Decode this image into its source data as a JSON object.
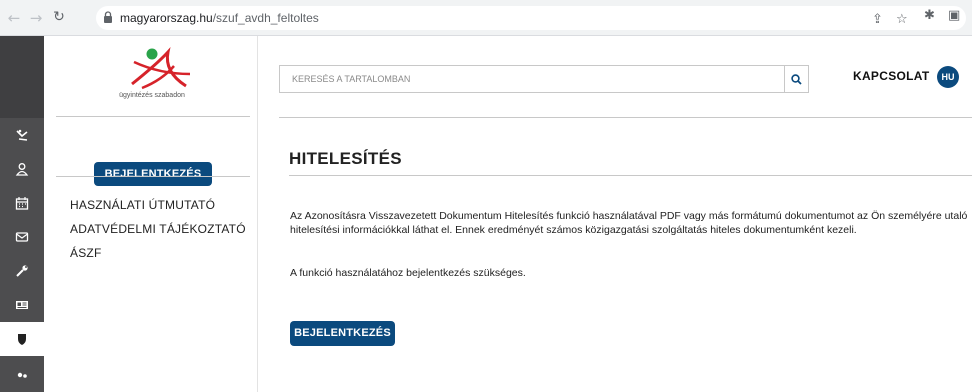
{
  "browser": {
    "url_host": "magyarorszag.hu",
    "url_path": "/szuf_avdh_feltoltes",
    "back_icon": "arrow-left-icon",
    "forward_icon": "arrow-right-icon",
    "reload_icon": "reload-icon"
  },
  "sidebar": {
    "logo_caption": "ügyintézés szabadon",
    "login_button": "BEJELENTKEZÉS",
    "links": [
      "HASZNÁLATI ÚTMUTATÓ",
      "ADATVÉDELMI TÁJÉKOZTATÓ",
      "ÁSZF"
    ]
  },
  "rail": {
    "items": [
      "person-skiing-icon",
      "user-icon",
      "calendar-icon",
      "mail-icon",
      "wrench-icon",
      "id-card-icon",
      "shield-icon",
      "users-icon"
    ],
    "active_index": 6
  },
  "header": {
    "search_placeholder": "KERESÉS A TARTALOMBAN",
    "contact": "KAPCSOLAT",
    "language": "HU"
  },
  "main": {
    "title": "HITELESÍTÉS",
    "paragraph": "Az Azonosításra Visszavezetett Dokumentum Hitelesítés funkció használatával PDF vagy más formátumú dokumentumot az Ön személyére utaló hitelesítési információkkal láthat el. Ennek eredményét számos közigazgatási szolgáltatás hiteles dokumentumként kezeli.",
    "note": "A funkció használatához bejelentkezés szükséges.",
    "login_button": "BEJELENTKEZÉS"
  },
  "colors": {
    "brand_blue": "#0b4a7e",
    "logo_red": "#d6232a",
    "logo_green": "#2aa34a",
    "rail_bg": "#4d4d4f"
  }
}
